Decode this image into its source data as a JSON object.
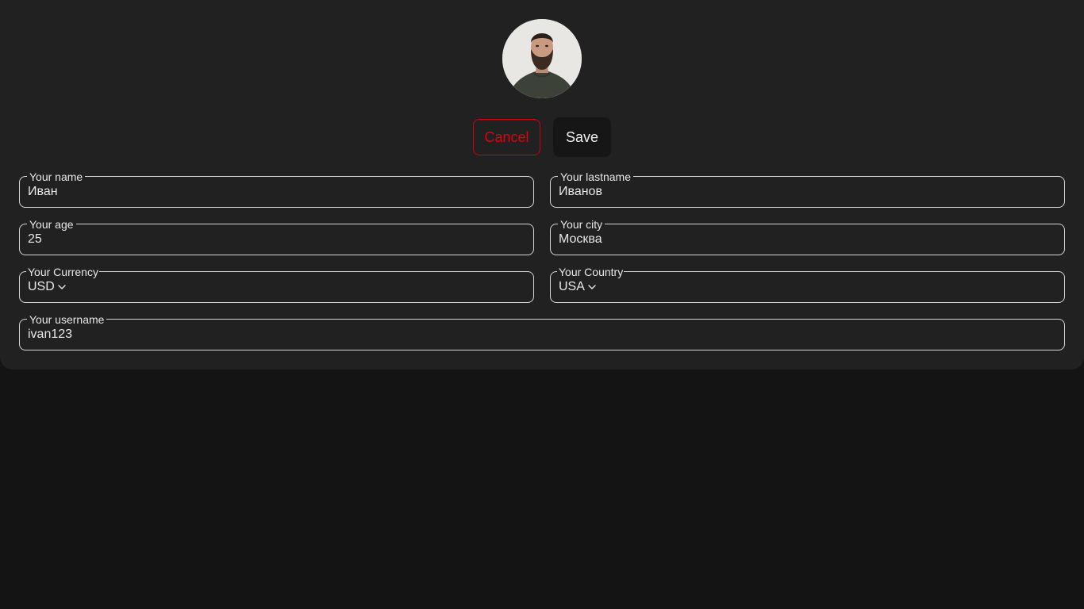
{
  "profile": {
    "avatar_icon": "user-photo"
  },
  "actions": {
    "cancel_label": "Cancel",
    "save_label": "Save",
    "cancel_color": "#e00010"
  },
  "form": {
    "name": {
      "label": "Your name",
      "value": "Иван"
    },
    "lastname": {
      "label": "Your lastname",
      "value": "Иванов"
    },
    "age": {
      "label": "Your age",
      "value": "25"
    },
    "city": {
      "label": "Your city",
      "value": "Москва"
    },
    "currency": {
      "label": "Your Currency",
      "value": "USD",
      "icon": "chevron-down-icon"
    },
    "country": {
      "label": "Your Country",
      "value": "USA",
      "icon": "chevron-down-icon"
    },
    "username": {
      "label": "Your username",
      "value": "ivan123"
    }
  }
}
